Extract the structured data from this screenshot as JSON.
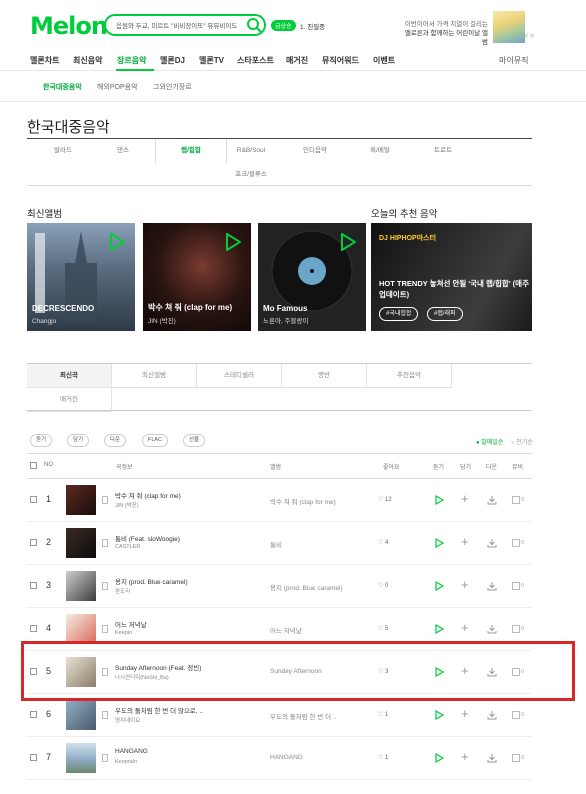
{
  "header": {
    "logo": "Melon",
    "search_text": "음원와 두교, 미르트 \"비비장이또\" 뮤뮤비이도",
    "rank_badge": "급상승",
    "rank_text": "1. 친필중",
    "ad_line1": "이번이어서 가격 치열이 걸리는",
    "ad_line2": "멜로른과 함께하는 어린이날 앨범",
    "ad_nav": "< >"
  },
  "gnb": {
    "items": [
      "멜론차트",
      "최신음악",
      "장르음악",
      "멜론DJ",
      "멜론TV",
      "스타포스트",
      "매거진",
      "뮤직어워드",
      "이벤트"
    ],
    "right": "마이뮤직"
  },
  "subnav": [
    "한국대중음악",
    "해외POP음악",
    "그외인기장르"
  ],
  "page_title": "한국대중음악",
  "genres": [
    "발라드",
    "댄스",
    "랩/힙합",
    "R&B/Soul",
    "인디음악",
    "록/메탈",
    "트로트",
    "포크/블루스"
  ],
  "new_albums": {
    "title": "최신앨범",
    "items": [
      {
        "title": "DECRESCENDO",
        "artist": "Changjo"
      },
      {
        "title": "박수 쳐 줘 (clap for me)",
        "artist": "JIN (박진)"
      },
      {
        "title": "Mo Famous",
        "artist": "노훈아, 주블랑이"
      }
    ]
  },
  "reco": {
    "title": "오늘의 추천 음악",
    "tag": "DJ HIPHOP마스터",
    "text": "HOT TRENDY 놓쳐선 안될 '국내 랩/힙합' (매주 업데이트)",
    "chips": [
      "#국내힙합",
      "#랩/래퍼"
    ]
  },
  "tabs": [
    "최신곡",
    "최신앨범",
    "스테디셀러",
    "명반",
    "추천음악",
    "매거진"
  ],
  "toolbar": {
    "buttons": [
      "듣기",
      "담기",
      "다운",
      "FLAC",
      "선물"
    ],
    "sort_on": "● 발매일순",
    "sort_off": "○ 인기순"
  },
  "table": {
    "headers": [
      "NO",
      "곡정보",
      "앨범",
      "좋아요",
      "듣기",
      "담기",
      "다운",
      "뮤비"
    ],
    "rows": [
      {
        "rank": "1",
        "song": "박수 쳐 줘 (clap for me)",
        "artist": "JIN (박진)",
        "album": "박수 쳐 줘 (clap for me)",
        "likes": "12",
        "mv": "0"
      },
      {
        "rank": "2",
        "song": "통비 (Feat. sloWoogie)",
        "artist": "CASTLER",
        "album": "통비",
        "likes": "4",
        "mv": "0"
      },
      {
        "rank": "3",
        "song": "용지 (prod. Blue caramel)",
        "artist": "판도리",
        "album": "용지 (prod. Blue caramel)",
        "likes": "0",
        "mv": "0"
      },
      {
        "rank": "4",
        "song": "어느 저녁날",
        "artist": "Keepin",
        "album": "어느 저녁날",
        "likes": "5",
        "mv": "0"
      },
      {
        "rank": "5",
        "song": "Sunday Afternoon (Feat. 정빈)",
        "artist": "나시끈더미(NaShi_Ba)",
        "album": "Sunday Afternoon",
        "likes": "3",
        "mv": "0"
      },
      {
        "rank": "6",
        "song": "우도의 돌처럼 한 번 더 앉으로, ..",
        "artist": "명치네이요",
        "album": "우도의 돌처럼 한 번 더 ..",
        "likes": "1",
        "mv": "0"
      },
      {
        "rank": "7",
        "song": "HANGANG",
        "artist": "Keeprain",
        "album": "HANGANG",
        "likes": "1",
        "mv": "0"
      }
    ]
  },
  "colors": {
    "brand": "#00cd3c",
    "highlight": "#d9262a"
  }
}
